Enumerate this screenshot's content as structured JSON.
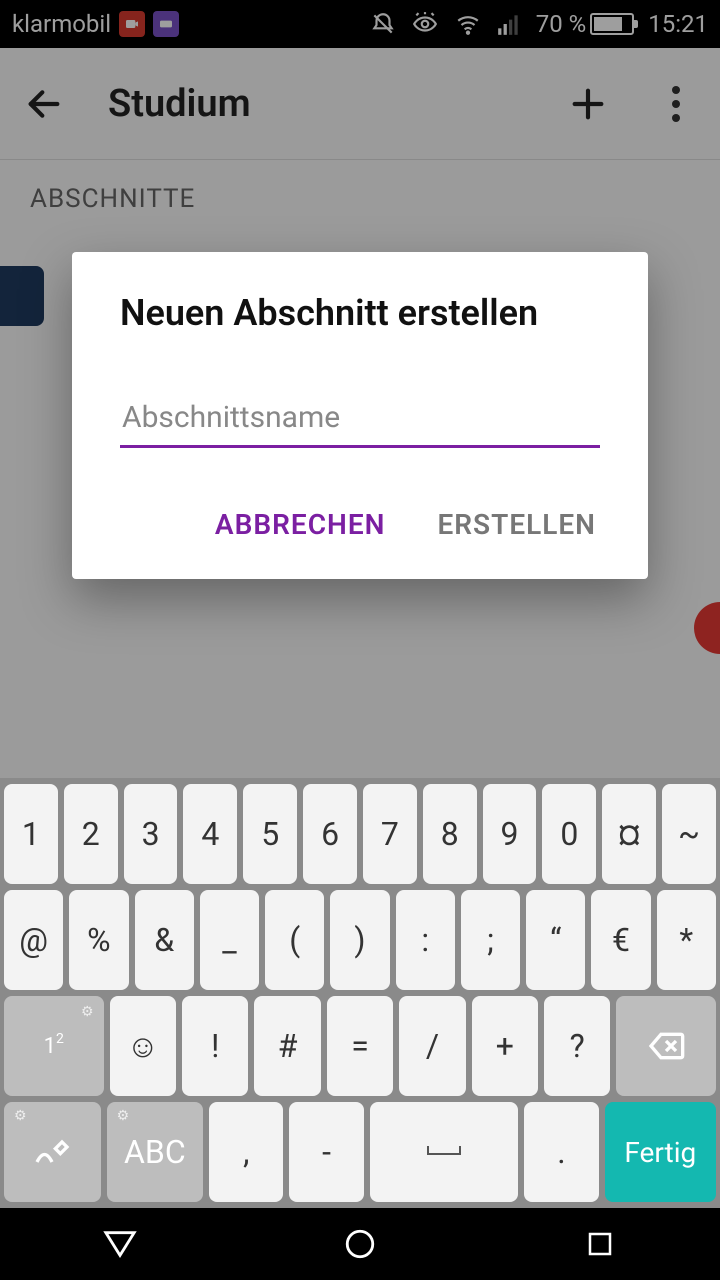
{
  "statusbar": {
    "carrier": "klarmobil",
    "battery_pct": "70 %",
    "time": "15:21"
  },
  "appbar": {
    "title": "Studium"
  },
  "content": {
    "sections_label": "ABSCHNITTE"
  },
  "dialog": {
    "title": "Neuen Abschnitt erstellen",
    "placeholder": "Abschnittsname",
    "value": "",
    "cancel": "ABBRECHEN",
    "create": "ERSTELLEN"
  },
  "keyboard": {
    "rows": [
      [
        "1",
        "2",
        "3",
        "4",
        "5",
        "6",
        "7",
        "8",
        "9",
        "0",
        "¤",
        "~"
      ],
      [
        "@",
        "%",
        "&",
        "_",
        "(",
        ")",
        ":",
        ";",
        "“",
        "€",
        "*"
      ],
      [
        "1²",
        "☺",
        "!",
        "#",
        "=",
        "/",
        "+",
        "?",
        "⌫"
      ],
      [
        "hand",
        "ABC",
        ",",
        "-",
        "␣",
        ".",
        "Fertig"
      ]
    ],
    "done": "Fertig",
    "abc": "ABC"
  }
}
